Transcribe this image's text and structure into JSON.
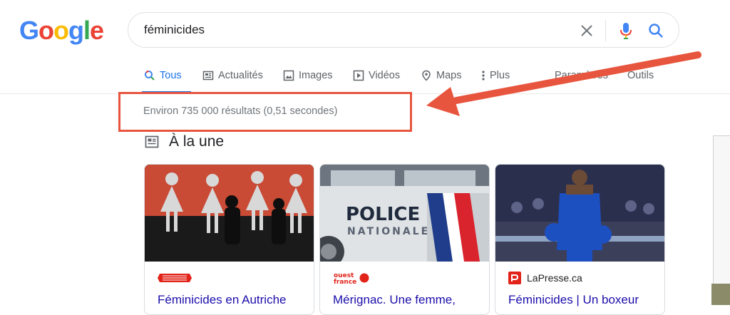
{
  "logo": {
    "text": "Google"
  },
  "search": {
    "value": "féminicides"
  },
  "tabs": [
    {
      "label": "Tous",
      "icon": "search-icon"
    },
    {
      "label": "Actualités",
      "icon": "news-icon"
    },
    {
      "label": "Images",
      "icon": "image-icon"
    },
    {
      "label": "Vidéos",
      "icon": "video-icon"
    },
    {
      "label": "Maps",
      "icon": "map-pin-icon"
    },
    {
      "label": "Plus",
      "icon": "more-vert-icon"
    },
    {
      "label": "Paramètres"
    },
    {
      "label": "Outils"
    }
  ],
  "results": {
    "stats": "Environ 735 000 résultats (0,51 secondes)"
  },
  "news": {
    "heading": "À la une",
    "cards": [
      {
        "source": "",
        "title": "Féminicides en Autriche"
      },
      {
        "source": "",
        "title": "Mérignac. Une femme,"
      },
      {
        "source": "LaPresse.ca",
        "title": "Féminicides | Un boxeur"
      }
    ]
  },
  "annotation": {
    "color": "#e8553e"
  },
  "colors": {
    "link": "#1a0dab",
    "active": "#1a73e8",
    "muted": "#70757a"
  }
}
